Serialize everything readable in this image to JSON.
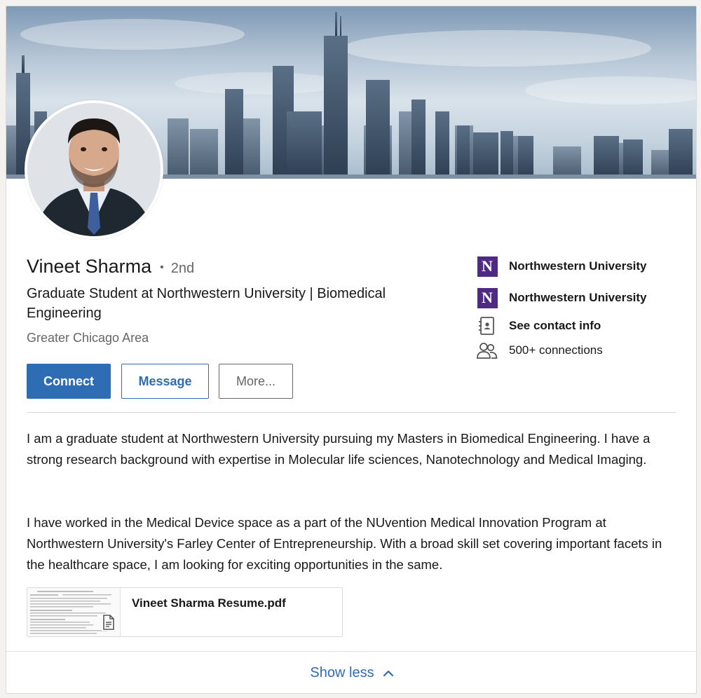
{
  "profile": {
    "name": "Vineet Sharma",
    "degree": "2nd",
    "headline": "Graduate Student at Northwestern University | Biomedical Engineering",
    "location": "Greater Chicago Area"
  },
  "actions": {
    "connect": "Connect",
    "message": "Message",
    "more": "More..."
  },
  "sidebar": {
    "logo_letter": "N",
    "items": [
      {
        "label": "Northwestern University",
        "icon": "northwestern-logo"
      },
      {
        "label": "Northwestern University",
        "icon": "northwestern-logo"
      },
      {
        "label": "See contact info",
        "icon": "contact-card-icon"
      },
      {
        "label": "500+ connections",
        "icon": "people-icon"
      }
    ]
  },
  "about": {
    "paragraphs": [
      "I am a graduate student at Northwestern University pursuing my Masters in Biomedical Engineering. I have a strong research background with expertise in Molecular life sciences, Nanotechnology and Medical Imaging.",
      "I have worked in the Medical Device space as a part of the NUvention Medical Innovation Program at Northwestern University's Farley Center of Entrepreneurship. With a broad skill set covering important facets in the healthcare space, I am looking for exciting opportunities in the same."
    ]
  },
  "attachment": {
    "title": "Vineet Sharma Resume.pdf"
  },
  "footer": {
    "show_less": "Show less"
  },
  "colors": {
    "accent": "#2e6db4",
    "school_purple": "#4e2a84",
    "muted_text": "#666666"
  }
}
